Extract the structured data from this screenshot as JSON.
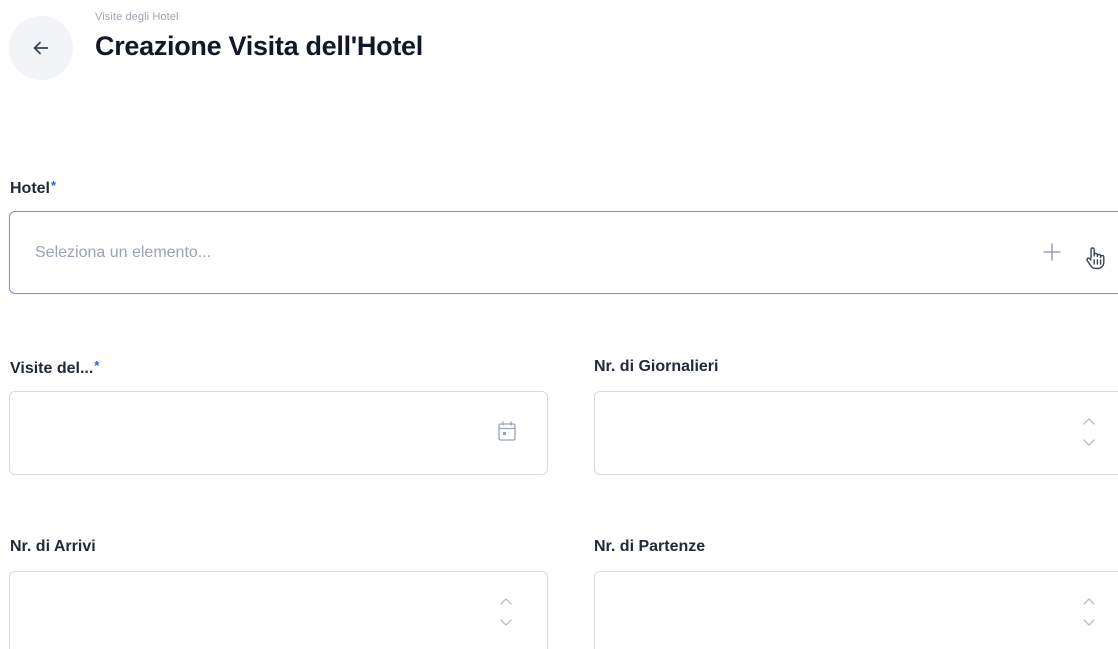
{
  "header": {
    "breadcrumb": "Visite degli Hotel",
    "title": "Creazione Visita dell'Hotel",
    "back_icon": "arrow-left-icon"
  },
  "form": {
    "hotel": {
      "label": "Hotel",
      "required_mark": "*",
      "placeholder": "Seleziona un elemento...",
      "add_icon": "plus-icon"
    },
    "visit_date": {
      "label": "Visite del...",
      "required_mark": "*",
      "value": "",
      "icon": "calendar-icon"
    },
    "daily_count": {
      "label": "Nr. di Giornalieri",
      "value": ""
    },
    "arrivals": {
      "label": "Nr. di Arrivi",
      "value": ""
    },
    "departures": {
      "label": "Nr. di Partenze",
      "value": ""
    }
  },
  "colors": {
    "accent": "#2563eb",
    "focus_border": "#7f96c6",
    "border": "#d7dbe2",
    "placeholder": "#9aa3b2",
    "back_button_bg": "#f3f4f7"
  }
}
